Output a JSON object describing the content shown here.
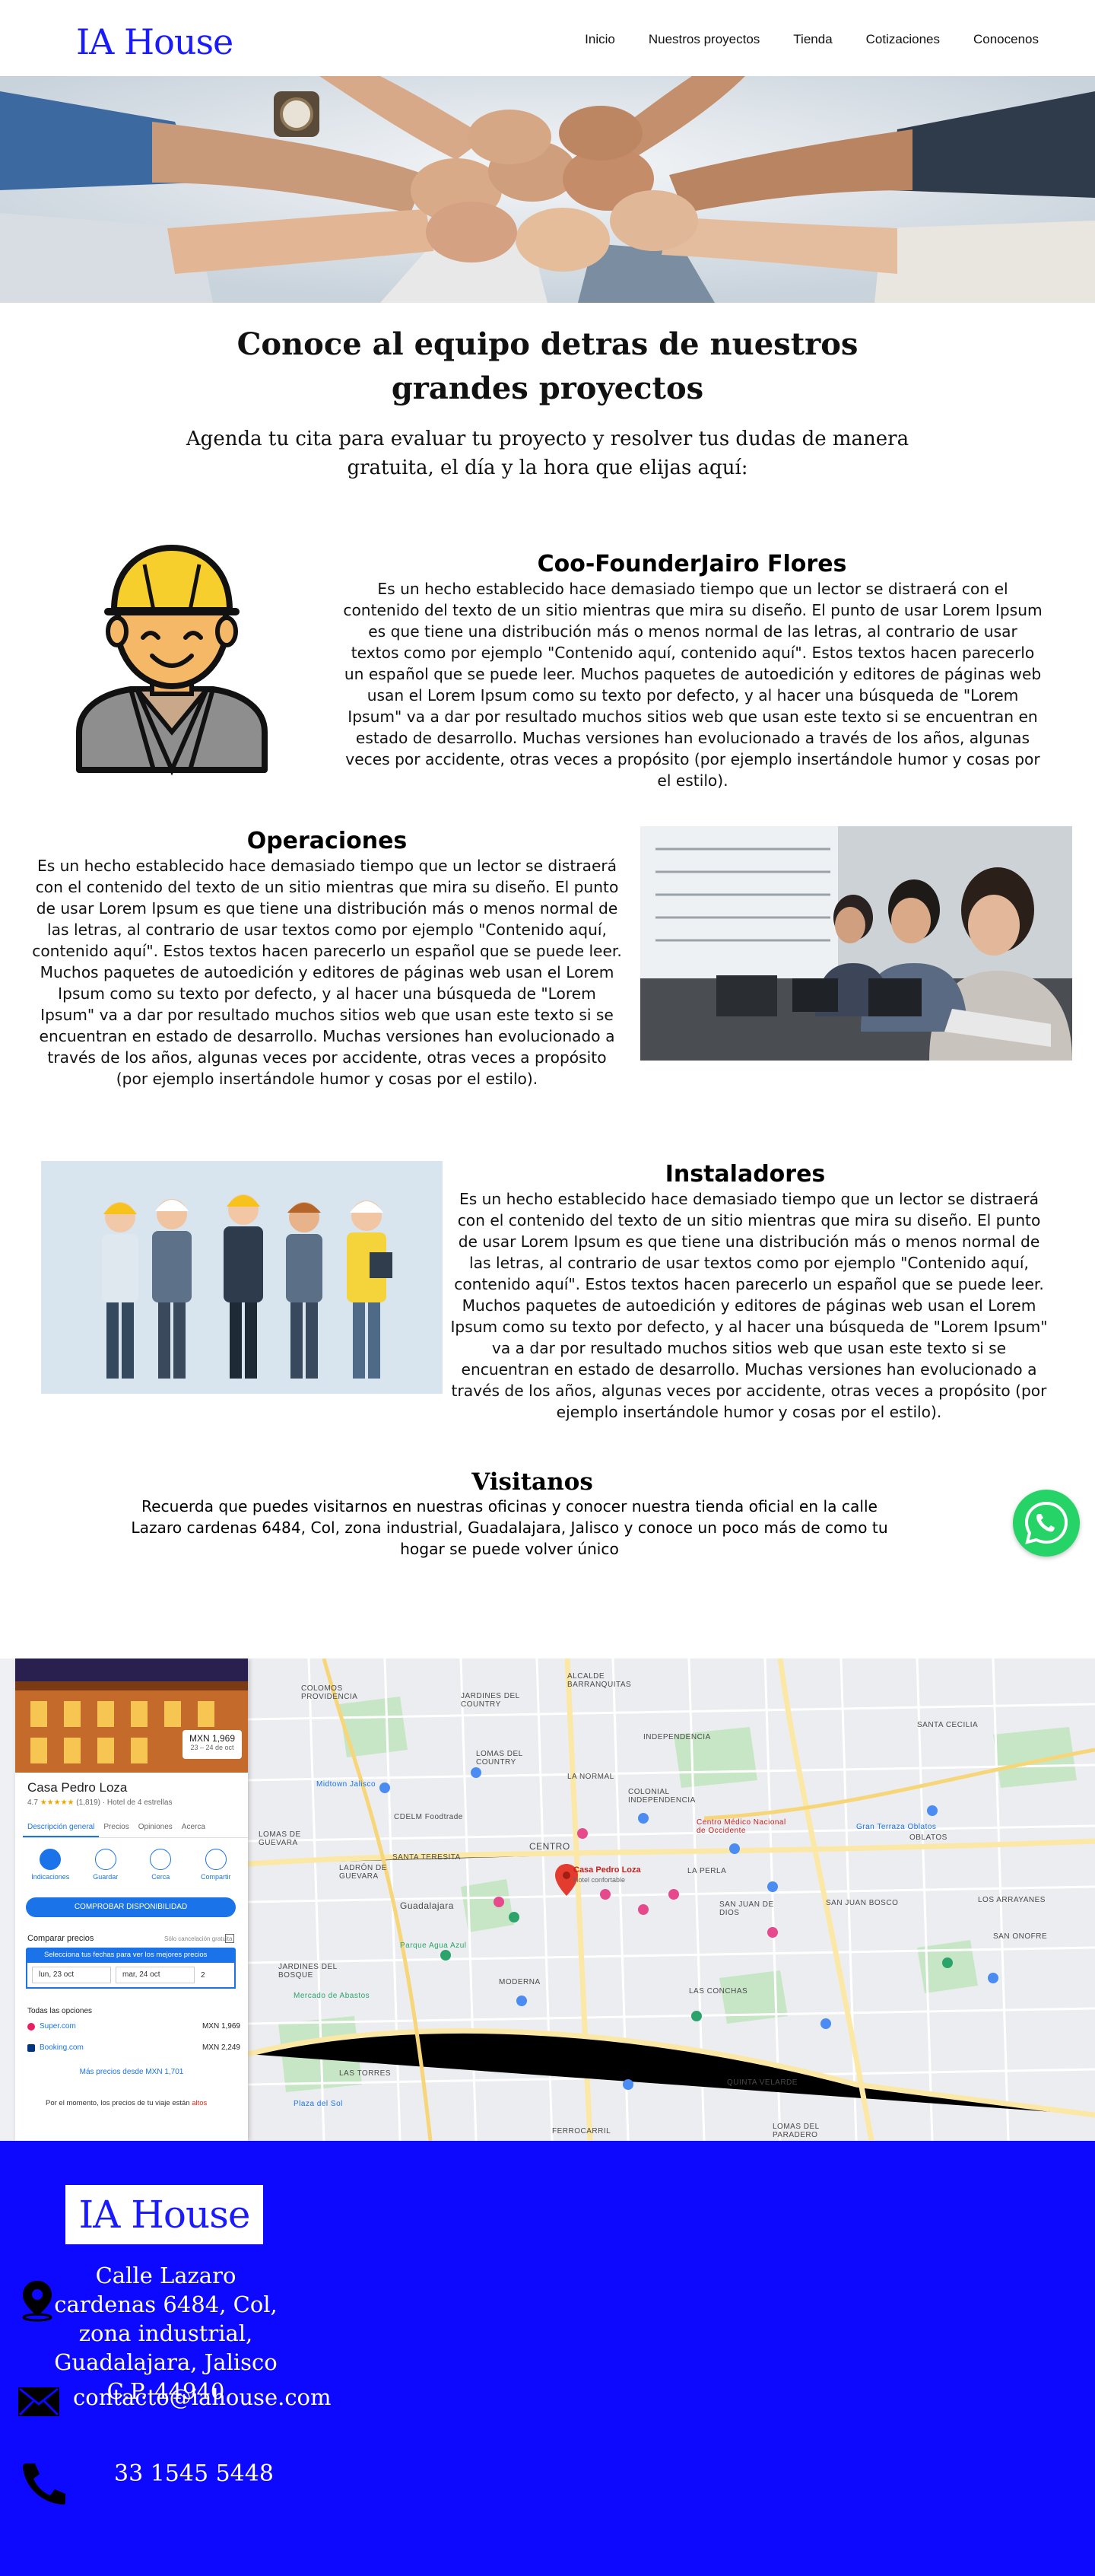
{
  "nav": {
    "logo": "IA House",
    "links": [
      "Inicio",
      "Nuestros proyectos",
      "Tienda",
      "Cotizaciones",
      "Conocenos"
    ]
  },
  "intro": {
    "title": "Conoce al equipo detras de nuestros grandes proyectos",
    "subtitle": "Agenda tu cita para evaluar tu proyecto y resolver tus dudas de manera gratuita, el día y la hora que elijas aquí:"
  },
  "founder": {
    "title": "Coo-FounderJairo Flores",
    "text": "Es un hecho establecido hace demasiado tiempo que un lector se distraerá con el contenido del texto de un sitio mientras que mira su diseño. El punto de usar Lorem Ipsum es que tiene una distribución más o menos normal de las letras, al contrario de usar textos como por ejemplo \"Contenido aquí, contenido aquí\". Estos textos hacen parecerlo un español que se puede leer. Muchos paquetes de autoedición y editores de páginas web usan el Lorem Ipsum como su texto por defecto, y al hacer una búsqueda de \"Lorem Ipsum\" va a dar por resultado muchos sitios web que usan este texto si se encuentran en estado de desarrollo. Muchas versiones han evolucionado a través de los años, algunas veces por accidente, otras veces a propósito (por ejemplo insertándole humor y cosas por el estilo)."
  },
  "operations": {
    "title": "Operaciones",
    "text": "Es un hecho establecido hace demasiado tiempo que un lector se distraerá con el contenido del texto de un sitio mientras que mira su diseño. El punto de usar Lorem Ipsum es que tiene una distribución más o menos normal de las letras, al contrario de usar textos como por ejemplo \"Contenido aquí, contenido aquí\". Estos textos hacen parecerlo un español que se puede leer. Muchos paquetes de autoedición y editores de páginas web usan el Lorem Ipsum como su texto por defecto, y al hacer una búsqueda de \"Lorem Ipsum\" va a dar por resultado muchos sitios web que usan este texto si se encuentran en estado de desarrollo. Muchas versiones han evolucionado a través de los años, algunas veces por accidente, otras veces a propósito (por ejemplo insertándole humor y cosas por el estilo)."
  },
  "installers": {
    "title": "Instaladores",
    "text": "Es un hecho establecido hace demasiado tiempo que un lector se distraerá con el contenido del texto de un sitio mientras que mira su diseño. El punto de usar Lorem Ipsum es que tiene una distribución más o menos normal de las letras, al contrario de usar textos como por ejemplo \"Contenido aquí, contenido aquí\". Estos textos hacen parecerlo un español que se puede leer. Muchos paquetes de autoedición y editores de páginas web usan el Lorem Ipsum como su texto por defecto, y al hacer una búsqueda de \"Lorem Ipsum\" va a dar por resultado muchos sitios web que usan este texto si se encuentran en estado de desarrollo. Muchas versiones han evolucionado a través de los años, algunas veces por accidente, otras veces a propósito (por ejemplo insertándole humor y cosas por el estilo)."
  },
  "visit": {
    "title": "Visitanos",
    "text": "Recuerda que puedes visitarnos en nuestras oficinas y conocer nuestra tienda oficial en la calle Lazaro cardenas 6484, Col, zona industrial, Guadalajara, Jalisco y conoce un poco más de como tu hogar se puede volver único"
  },
  "map": {
    "price": "MXN 1,969",
    "price_dates": "23 – 24 de oct",
    "hotel_name": "Casa Pedro Loza",
    "rating": "4.7",
    "stars": "★★★★★",
    "reviews": "(1,819)",
    "hotel_class": "· Hotel de 4 estrellas",
    "tabs": [
      "Descripción general",
      "Precios",
      "Opiniones",
      "Acerca"
    ],
    "actions": [
      "Indicaciones",
      "Guardar",
      "Cerca",
      "Compartir"
    ],
    "check_button": "COMPROBAR DISPONIBILIDAD",
    "compare_label": "Comparar precios",
    "compare_free": "Sólo cancelación gratuita",
    "dates_banner": "Selecciona tus fechas para ver los mejores precios",
    "checkin": "lun, 23 oct",
    "checkout": "mar, 24 oct",
    "guests": "2",
    "all_options": "Todas las opciones",
    "options": [
      {
        "name": "Super.com",
        "price": "MXN 1,969"
      },
      {
        "name": "Booking.com",
        "price": "MXN 2,249"
      }
    ],
    "more_prices": "Más precios desde MXN 1,701",
    "note_prefix": "Por el momento, los precios de tu viaje están",
    "note_status": "altos",
    "marker_label": "Casa Pedro Loza",
    "marker_sub": "Hotel confortable",
    "labels": [
      "COLOMOS PROVIDENCIA",
      "JARDINES DEL COUNTRY",
      "ALCALDE BARRANQUITAS",
      "INDEPENDENCIA",
      "SANTA CECILIA",
      "LOMAS DEL COUNTRY",
      "LA NORMAL",
      "COLONIAL INDEPENDENCIA",
      "Midtown Jalisco",
      "CDELM Foodtrade",
      "LOMAS DE GUEVARA",
      "LADRÓN DE GUEVARA",
      "SANTA TERESITA",
      "CENTRO",
      "LA PERLA",
      "Guadalajara",
      "SAN JUAN DE DIOS",
      "LAS CONCHAS",
      "MODERNA",
      "JARDINES DEL BOSQUE",
      "LAS TORRES",
      "FERROCARRIL",
      "QUINTA VELARDE",
      "LOMAS DEL PARADERO",
      "LOS ARRAYANES",
      "SAN ONOFRE",
      "SAN JUAN BOSCO",
      "OBLATOS",
      "Mercado de Abastos",
      "Parque Agua Azul",
      "Plaza del Sol",
      "Centro Médico Nacional de Occidente",
      "Gran Terraza Oblatos"
    ]
  },
  "footer": {
    "logo": "IA House",
    "address": "Calle Lazaro cardenas 6484, Col, zona industrial, Guadalajara, Jalisco C.P. 44940",
    "email": "contacto@iahouse.com",
    "phone": "33 1545 5448"
  },
  "colors": {
    "brand_blue": "#1a1aff",
    "footer_blue": "#0d08ff",
    "whatsapp": "#25d366",
    "map_blue": "#1a73e8"
  }
}
